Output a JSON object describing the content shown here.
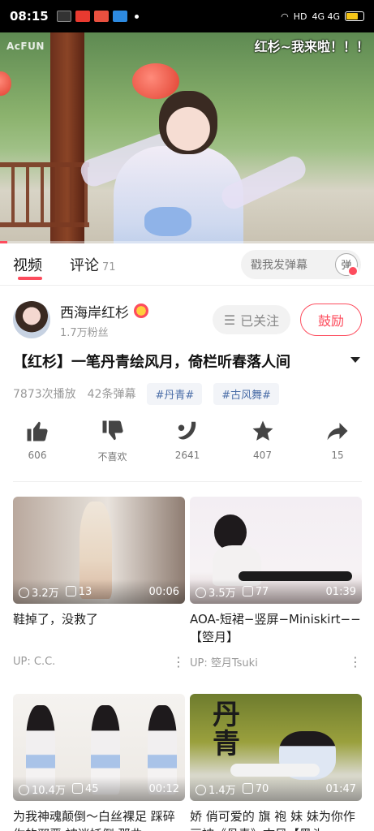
{
  "status_bar": {
    "time": "08:15",
    "network": "HD",
    "signal": "4G 4G"
  },
  "player": {
    "watermark": "AcFUN",
    "danmaku_text": "红杉~我来啦！！！",
    "progress_fraction": 0.02
  },
  "tabs": {
    "video_label": "视频",
    "comment_label": "评论",
    "comment_count": "71",
    "danmaku_placeholder": "戳我发弹幕",
    "danmaku_toggle": "弹"
  },
  "uploader": {
    "name": "西海岸红杉",
    "fans": "1.7万粉丝",
    "follow_label": "已关注",
    "encourage_label": "鼓励"
  },
  "video": {
    "title": "【红杉】一笔丹青绘风月，倚栏听春落人间",
    "plays": "7873次播放",
    "danmaku": "42条弹幕",
    "tags": [
      "#丹青#",
      "#古风舞#"
    ]
  },
  "actions": [
    {
      "icon": "thumbs-up-icon",
      "label": "606"
    },
    {
      "icon": "thumbs-down-icon",
      "label": "不喜欢"
    },
    {
      "icon": "banana-icon",
      "label": "2641"
    },
    {
      "icon": "star-icon",
      "label": "407"
    },
    {
      "icon": "share-icon",
      "label": "15"
    }
  ],
  "recommendations": [
    {
      "plays": "3.2万",
      "comments": "13",
      "duration": "00:06",
      "title": "鞋掉了，没救了",
      "up": "UP: C.C."
    },
    {
      "plays": "3.5万",
      "comments": "77",
      "duration": "01:39",
      "title": "AOA-短裙−竖屏−Miniskirt−−【箜月】",
      "up": "UP: 箜月Tsuki"
    },
    {
      "plays": "10.4万",
      "comments": "45",
      "duration": "00:12",
      "title": "为我神魂颠倒～白丝裸足 踩碎你的邪恶 被迷妖倒 那曲",
      "up": ""
    },
    {
      "plays": "1.4万",
      "comments": "70",
      "duration": "01:47",
      "title": "娇 俏可爱的 旗 袍 妹 妹为你作画被《丹青》古风【黑头",
      "up": "",
      "overlay": "丹青"
    }
  ]
}
